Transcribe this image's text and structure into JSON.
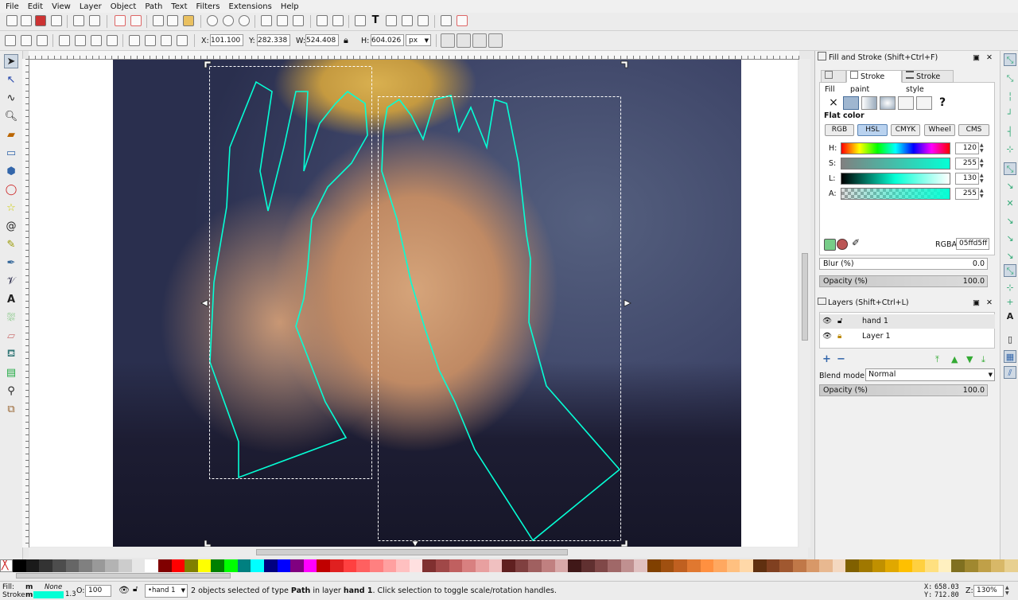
{
  "menu": [
    "File",
    "Edit",
    "View",
    "Layer",
    "Object",
    "Path",
    "Text",
    "Filters",
    "Extensions",
    "Help"
  ],
  "selectbar": {
    "x_label": "X:",
    "x": "101.100",
    "y_label": "Y:",
    "y": "282.338",
    "w_label": "W:",
    "w": "524.408",
    "h_label": "H:",
    "h": "604.026",
    "unit": "px"
  },
  "fill_stroke": {
    "title": "Fill and Stroke (Shift+Ctrl+F)",
    "tabs": [
      "Fill",
      "Stroke paint",
      "Stroke style"
    ],
    "flat_color": "Flat color",
    "unset_symbol": "×",
    "unknown_symbol": "?",
    "models": [
      "RGB",
      "HSL",
      "CMYK",
      "Wheel",
      "CMS"
    ],
    "channels": [
      {
        "label": "H:",
        "value": "120"
      },
      {
        "label": "S:",
        "value": "255"
      },
      {
        "label": "L:",
        "value": "130"
      },
      {
        "label": "A:",
        "value": "255"
      }
    ],
    "rgba_label": "RGBA:",
    "rgba": "05ffd5ff",
    "blur_label": "Blur (%)",
    "blur": "0.0",
    "opacity_label": "Opacity (%)",
    "opacity": "100.0",
    "stroke_color": "#05ffd5"
  },
  "layers": {
    "title": "Layers (Shift+Ctrl+L)",
    "items": [
      {
        "name": "hand 1"
      },
      {
        "name": "Layer 1"
      }
    ],
    "blend_label": "Blend mode:",
    "blend": "Normal",
    "opacity_label": "Opacity (%)",
    "opacity": "100.0"
  },
  "status": {
    "fill_label": "Fill:",
    "fill_value": "m",
    "stroke_label": "Stroke:",
    "stroke_value": "m",
    "none": "None",
    "stroke_width": "1.3",
    "o_label": "O:",
    "o_value": "100",
    "layer": "•hand 1",
    "message_pre": "2 objects selected of type ",
    "message_type": "Path",
    "message_mid": " in layer ",
    "message_layer": "hand 1",
    "message_post": ". Click selection to toggle scale/rotation handles.",
    "x_label": "X:",
    "x": "658.03",
    "y_label": "Y:",
    "y": "712.80",
    "z_label": "Z:",
    "zoom": "130%"
  },
  "palette": [
    "#000000",
    "#1a1a1a",
    "#333333",
    "#4d4d4d",
    "#666666",
    "#808080",
    "#999999",
    "#b3b3b3",
    "#cccccc",
    "#e6e6e6",
    "#ffffff",
    "#800000",
    "#ff0000",
    "#808000",
    "#ffff00",
    "#008000",
    "#00ff00",
    "#008080",
    "#00ffff",
    "#000080",
    "#0000ff",
    "#800080",
    "#ff00ff",
    "#c00000",
    "#e02020",
    "#ff4040",
    "#ff6060",
    "#ff8080",
    "#ffa0a0",
    "#ffc0c0",
    "#ffe0e0",
    "#803030",
    "#a04848",
    "#c06060",
    "#d88080",
    "#e8a0a0",
    "#f0c0c0",
    "#602020",
    "#804040",
    "#a06060",
    "#c08080",
    "#d8a8a8",
    "#401818",
    "#603030",
    "#804848",
    "#a06868",
    "#c09090",
    "#e0c0c0",
    "#804000",
    "#a05010",
    "#c06020",
    "#e07830",
    "#ff9040",
    "#ffa860",
    "#ffc080",
    "#ffd8a8",
    "#603010",
    "#804020",
    "#a05830",
    "#c07848",
    "#d89868",
    "#e8b890",
    "#f4d8c0",
    "#806000",
    "#a07800",
    "#c09000",
    "#e0a800",
    "#ffc000",
    "#ffd040",
    "#ffe080",
    "#fff0c0",
    "#807020",
    "#a08830",
    "#c0a048",
    "#d8b868",
    "#e8d090"
  ]
}
